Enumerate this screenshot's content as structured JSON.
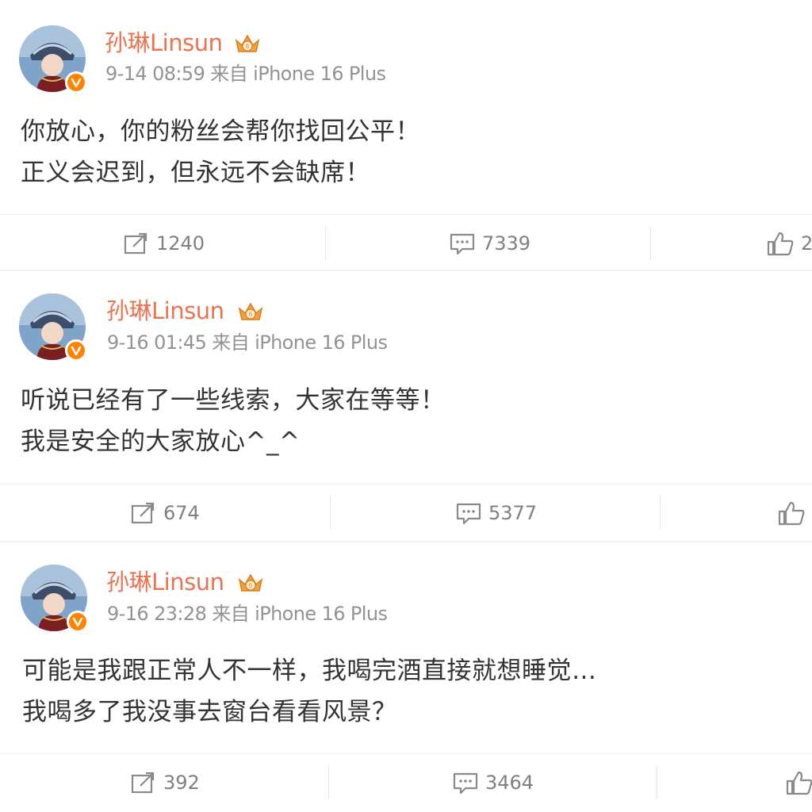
{
  "posts": [
    {
      "username": "孙琳Linsun",
      "time": "9-14 08:59",
      "source": "来自 iPhone 16 Plus",
      "lines": [
        "你放心，你的粉丝会帮你找回公平！",
        "正义会迟到，但永远不会缺席！"
      ],
      "reposts": "1240",
      "comments": "7339",
      "likes": "2"
    },
    {
      "username": "孙琳Linsun",
      "time": "9-16 01:45",
      "source": "来自 iPhone 16 Plus",
      "lines": [
        "听说已经有了一些线索，大家在等等！",
        "我是安全的大家放心^_^"
      ],
      "reposts": "674",
      "comments": "5377",
      "likes": ""
    },
    {
      "username": "孙琳Linsun",
      "time": "9-16 23:28",
      "source": "来自 iPhone 16 Plus",
      "lines": [
        "可能是我跟正常人不一样，我喝完酒直接就想睡觉…",
        "我喝多了我没事去窗台看看风景？"
      ],
      "reposts": "392",
      "comments": "3464",
      "likes": ""
    }
  ],
  "colors": {
    "username": "#eb7350",
    "meta": "#939393",
    "action": "#808080",
    "verified": "#ff8200"
  },
  "icons": {
    "avatar": "avatar-image",
    "verified": "verified-v-icon",
    "crown": "member-crown-icon",
    "repost": "repost-icon",
    "comment": "comment-icon",
    "like": "like-icon"
  }
}
